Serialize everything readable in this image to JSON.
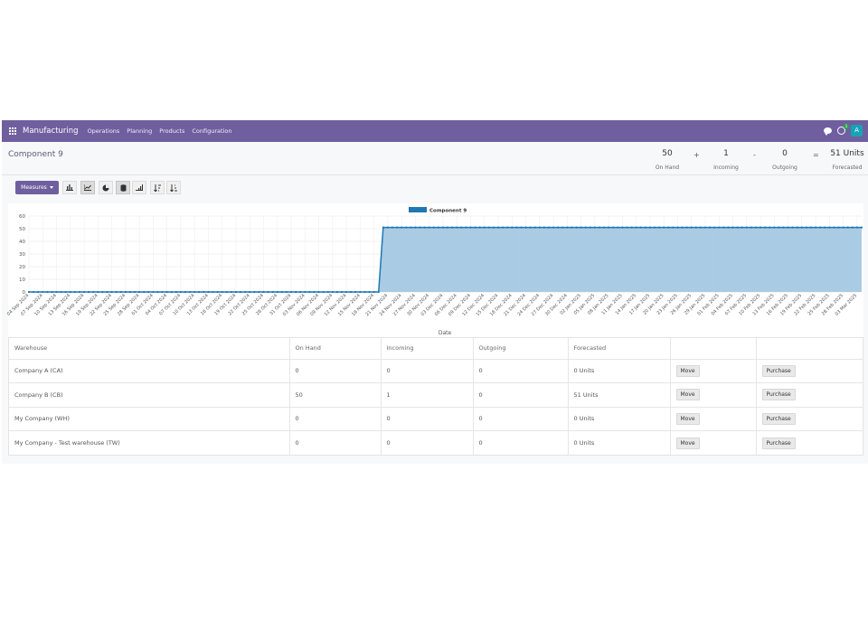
{
  "nav": {
    "brand": "Manufacturing",
    "items": [
      "Operations",
      "Planning",
      "Products",
      "Configuration"
    ],
    "activity_count": "1",
    "avatar_letter": "A"
  },
  "page": {
    "title": "Component 9"
  },
  "stats": {
    "on_hand": {
      "value": "50",
      "label": "On Hand"
    },
    "plus": "+",
    "incoming": {
      "value": "1",
      "label": "Incoming"
    },
    "minus": "-",
    "outgoing": {
      "value": "0",
      "label": "Outgoing"
    },
    "equals": "=",
    "forecasted": {
      "value": "51 Units",
      "label": "Forecasted"
    }
  },
  "toolbar": {
    "measures_label": "Measures",
    "buttons": [
      "bar-chart-icon",
      "line-chart-icon",
      "pie-chart-icon",
      "stacked-icon",
      "cumulative-icon",
      "sort-descending-icon",
      "sort-ascending-icon"
    ]
  },
  "chart_data": {
    "type": "area",
    "legend": [
      "Component 9"
    ],
    "legend_position": "top-center",
    "xlabel": "Date",
    "ylabel": "",
    "ylim": [
      0,
      60
    ],
    "yticks": [
      0,
      10,
      20,
      30,
      40,
      50,
      60
    ],
    "grid": true,
    "color": "#1f77b4",
    "fill": "#a4c8e3",
    "x_tick_labels": [
      "04 Sep 2024",
      "07 Sep 2024",
      "10 Sep 2024",
      "13 Sep 2024",
      "16 Sep 2024",
      "19 Sep 2024",
      "22 Sep 2024",
      "25 Sep 2024",
      "28 Sep 2024",
      "01 Oct 2024",
      "04 Oct 2024",
      "07 Oct 2024",
      "10 Oct 2024",
      "13 Oct 2024",
      "16 Oct 2024",
      "19 Oct 2024",
      "22 Oct 2024",
      "25 Oct 2024",
      "28 Oct 2024",
      "31 Oct 2024",
      "03 Nov 2024",
      "06 Nov 2024",
      "09 Nov 2024",
      "12 Nov 2024",
      "15 Nov 2024",
      "18 Nov 2024",
      "21 Nov 2024",
      "24 Nov 2024",
      "27 Nov 2024",
      "30 Nov 2024",
      "03 Dec 2024",
      "06 Dec 2024",
      "09 Dec 2024",
      "12 Dec 2024",
      "15 Dec 2024",
      "18 Dec 2024",
      "21 Dec 2024",
      "24 Dec 2024",
      "27 Dec 2024",
      "30 Dec 2024",
      "02 Jan 2025",
      "05 Jan 2025",
      "08 Jan 2025",
      "11 Jan 2025",
      "14 Jan 2025",
      "17 Jan 2025",
      "20 Jan 2025",
      "23 Jan 2025",
      "26 Jan 2025",
      "29 Jan 2025",
      "01 Feb 2025",
      "04 Feb 2025",
      "07 Feb 2025",
      "10 Feb 2025",
      "13 Feb 2025",
      "16 Feb 2025",
      "19 Feb 2025",
      "22 Feb 2025",
      "25 Feb 2025",
      "28 Feb 2025",
      "03 Mar 2025"
    ],
    "series": [
      {
        "name": "Component 9",
        "segments": [
          {
            "from": "04 Sep 2024",
            "to": "19 Nov 2024",
            "value": 0
          },
          {
            "from": "20 Nov 2024",
            "to": "04 Mar 2025",
            "value": 51
          }
        ]
      }
    ]
  },
  "table": {
    "headers": [
      "Warehouse",
      "On Hand",
      "Incoming",
      "Outgoing",
      "Forecasted",
      "",
      ""
    ],
    "move_label": "Move",
    "purchase_label": "Purchase",
    "rows": [
      {
        "warehouse": "Company A (CA)",
        "on_hand": "0",
        "incoming": "0",
        "outgoing": "0",
        "forecasted": "0 Units"
      },
      {
        "warehouse": "Company B (CB)",
        "on_hand": "50",
        "incoming": "1",
        "outgoing": "0",
        "forecasted": "51 Units"
      },
      {
        "warehouse": "My Company (WH)",
        "on_hand": "0",
        "incoming": "0",
        "outgoing": "0",
        "forecasted": "0 Units"
      },
      {
        "warehouse": "My Company - Test warehouse (TW)",
        "on_hand": "0",
        "incoming": "0",
        "outgoing": "0",
        "forecasted": "0 Units"
      }
    ]
  }
}
